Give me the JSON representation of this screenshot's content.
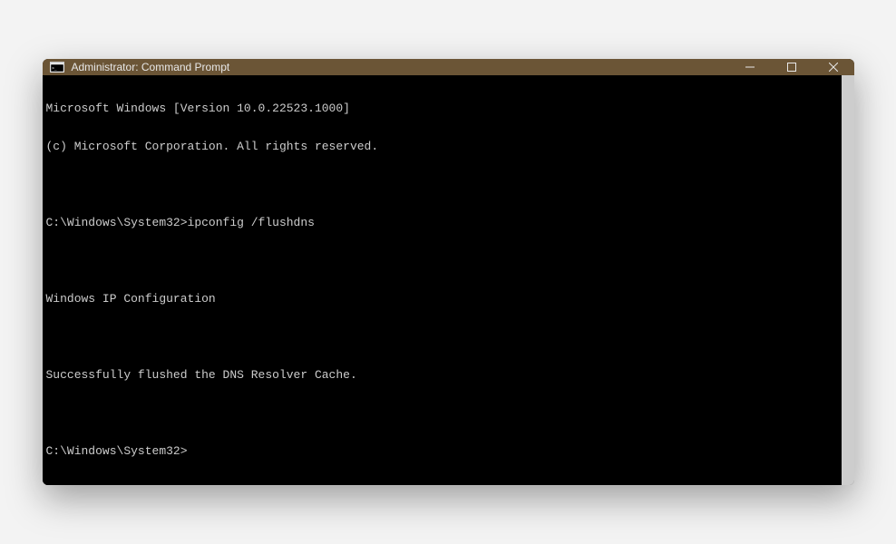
{
  "window": {
    "title": "Administrator: Command Prompt"
  },
  "terminal": {
    "lines": [
      "Microsoft Windows [Version 10.0.22523.1000]",
      "(c) Microsoft Corporation. All rights reserved.",
      "",
      "C:\\Windows\\System32>ipconfig /flushdns",
      "",
      "Windows IP Configuration",
      "",
      "Successfully flushed the DNS Resolver Cache.",
      "",
      "C:\\Windows\\System32>"
    ]
  }
}
